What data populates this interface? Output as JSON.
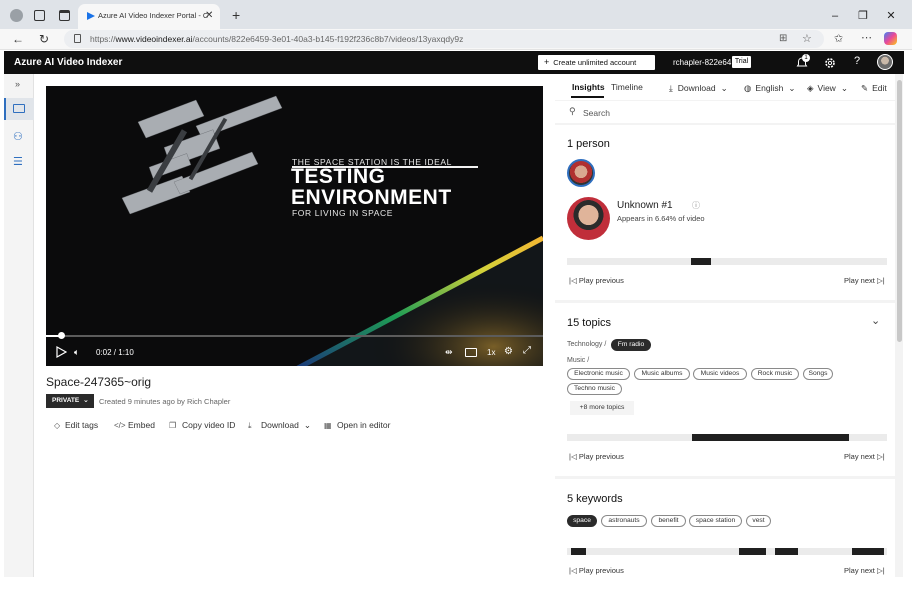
{
  "browser": {
    "tab_title": "Azure AI Video Indexer Portal - C",
    "new_tab_symbol": "+",
    "url_prefix": "https://",
    "url_host": "www.videoindexer.ai",
    "url_path": "/accounts/822e6459-3e01-40a3-b145-f192f236c8b7/videos/13yaxqdy9z"
  },
  "app": {
    "title": "Azure AI Video Indexer",
    "create_button": "Create unlimited account",
    "user": "rchapler-822e64",
    "badge": "Trial",
    "notification_count": "1"
  },
  "video": {
    "overlay_line1": "THE SPACE STATION IS THE IDEAL",
    "overlay_big1": "TESTING",
    "overlay_big2": "ENVIRONMENT",
    "overlay_line2": "FOR LIVING IN SPACE",
    "time": "0:02 / 1:10",
    "progress": 0.03,
    "speed": "1x",
    "title": "Space-247365~orig",
    "privacy": "PRIVATE",
    "created": "Created 9 minutes ago by Rich Chapler",
    "actions": [
      "Edit tags",
      "Embed",
      "Copy video ID",
      "Download",
      "Open in editor"
    ]
  },
  "insights": {
    "tabs": [
      "Insights",
      "Timeline"
    ],
    "toolbar": {
      "download": "Download",
      "language": "English",
      "view": "View",
      "edit": "Edit"
    },
    "search_placeholder": "Search",
    "people": {
      "title": "1 person",
      "name": "Unknown #1",
      "appears": "Appears in 6.64% of video",
      "play_previous": "Play previous",
      "play_next": "Play next"
    },
    "topics": {
      "title": "15 topics",
      "group1": "Technology /",
      "group1_pill": "Fm radio",
      "group2": "Music /",
      "music_pills": [
        "Electronic music",
        "Music albums",
        "Music videos",
        "Rock music",
        "Songs",
        "Techno music"
      ],
      "more": "+8 more topics",
      "play_previous": "Play previous",
      "play_next": "Play next"
    },
    "keywords": {
      "title": "5 keywords",
      "pills": [
        "space",
        "astronauts",
        "benefit",
        "space station",
        "vest"
      ],
      "play_previous": "Play previous",
      "play_next": "Play next"
    }
  },
  "colors": {
    "app_header": "#0f0f0f",
    "panel_bg": "#f3f3f3",
    "timeline_bar": "#202020"
  }
}
